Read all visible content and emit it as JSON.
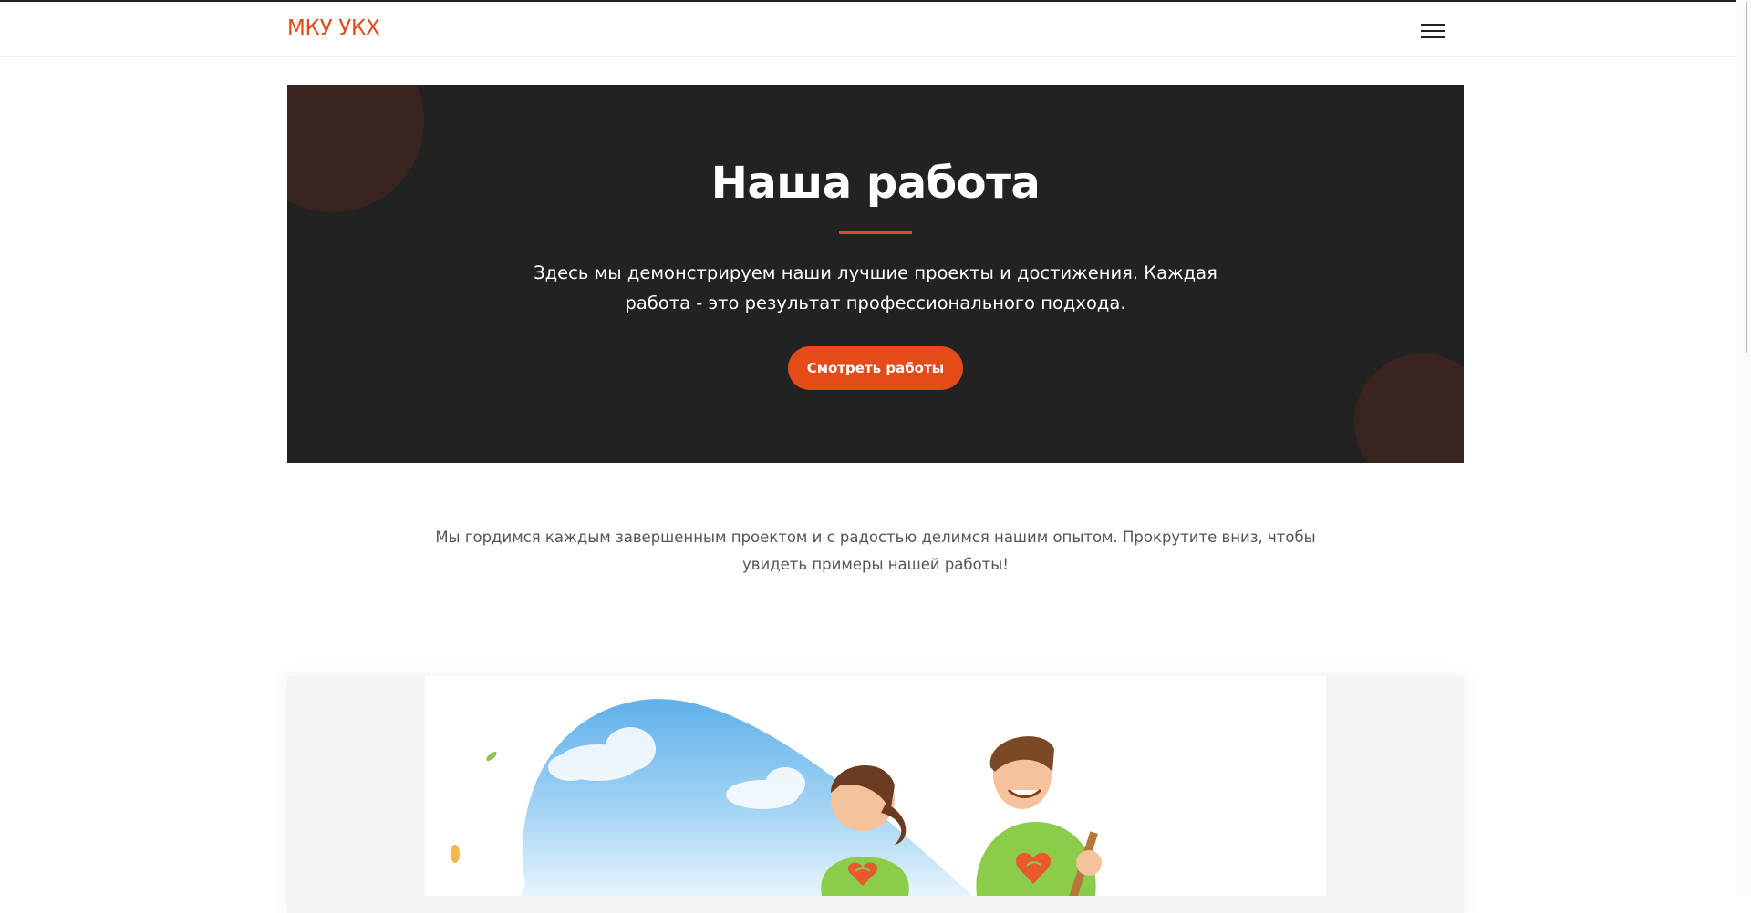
{
  "theme": {
    "accent": "#e54a19",
    "hero_bg": "#222222",
    "hero_blob": "#3a2420"
  },
  "navbar": {
    "brand": "МКУ УКХ",
    "menu_icon": "hamburger-menu-icon"
  },
  "hero": {
    "title": "Наша работа",
    "description": "Здесь мы демонстрируем наши лучшие проекты и достижения. Каждая работа - это результат профессионального подхода.",
    "button_label": "Смотреть работы"
  },
  "intro": {
    "text": "Мы гордимся каждым завершенным проектом и с радостью делимся нашим опытом. Прокрутите вниз, чтобы увидеть примеры нашей работы!"
  },
  "gallery": {
    "image_icon": "volunteers-illustration"
  }
}
